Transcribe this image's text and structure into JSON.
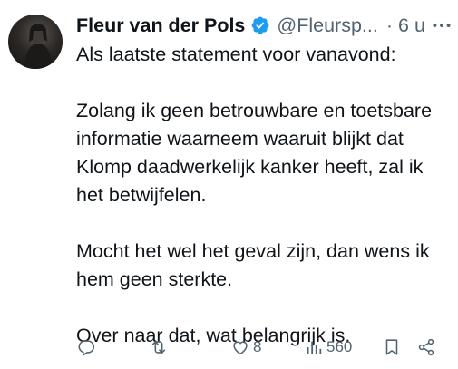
{
  "tweet": {
    "author_name": "Fleur van der Pols",
    "handle": "@Fleursp...",
    "separator": "·",
    "time_ago": "6 u",
    "paragraphs": [
      "Als laatste statement voor vanavond:",
      "Zolang ik geen betrouwbare en toetsbare informatie waarneem waaruit blijkt dat Klomp daadwerkelijk kanker heeft, zal ik het betwijfelen.",
      "Mocht het wel het geval zijn, dan wens ik hem geen sterkte.",
      "Over naar dat, wat belangrijk is."
    ],
    "metrics": {
      "likes": "8",
      "views": "560"
    }
  },
  "colors": {
    "verified_badge": "#1d9bf0",
    "secondary_text": "#536471",
    "primary_text": "#0f1419"
  },
  "icons": {
    "avatar": "profile-photo",
    "badge": "verified-badge-icon",
    "more": "more-options-icon",
    "reply": "reply-icon",
    "repost": "repost-icon",
    "like": "heart-icon",
    "views": "views-chart-icon",
    "bookmark": "bookmark-icon",
    "share": "share-icon"
  }
}
